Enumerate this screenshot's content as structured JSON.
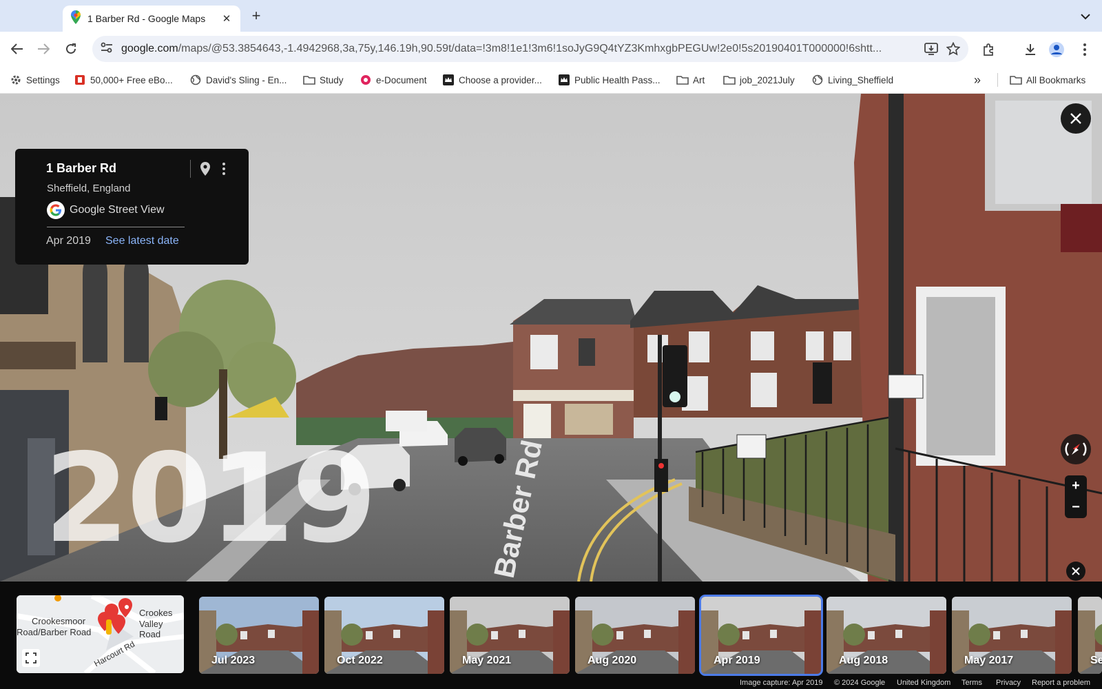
{
  "browser": {
    "tab_title": "1 Barber Rd - Google Maps",
    "url_host": "google.com",
    "url_path": "/maps/@53.3854643,-1.4942968,3a,75y,146.19h,90.59t/data=!3m8!1e1!3m6!1soJyG9Q4tYZ3KmhxgbPEGUw!2e0!5s20190401T000000!6shtt..."
  },
  "bookmarks": {
    "items": [
      {
        "label": "Settings",
        "icon": "gear-icon"
      },
      {
        "label": "50,000+ Free eBo...",
        "icon": "book-icon"
      },
      {
        "label": "David's Sling - En...",
        "icon": "globe-icon"
      },
      {
        "label": "Study",
        "icon": "folder-icon"
      },
      {
        "label": "e-Document",
        "icon": "doc-icon"
      },
      {
        "label": "Choose a provider...",
        "icon": "crown-icon"
      },
      {
        "label": "Public Health Pass...",
        "icon": "crown-icon"
      },
      {
        "label": "Art",
        "icon": "folder-icon"
      },
      {
        "label": "job_2021July",
        "icon": "folder-icon"
      },
      {
        "label": "Living_Sheffield",
        "icon": "globe-icon"
      }
    ],
    "all_bookmarks": "All Bookmarks"
  },
  "infocard": {
    "title": "1 Barber Rd",
    "subtitle": "Sheffield, England",
    "brand": "Google Street View",
    "date": "Apr 2019",
    "latest_link": "See latest date"
  },
  "scene": {
    "year_overlay": "2019",
    "road_text": "Barber Rd"
  },
  "minimap": {
    "label_1_line1": "Crookesmoor",
    "label_1_line2": "Road/Barber Road",
    "label_2_line1": "Crookes",
    "label_2_line2": "Valley Road",
    "label_3": "Harcourt Rd"
  },
  "timeline": [
    {
      "label": "Jul 2023",
      "selected": false
    },
    {
      "label": "Oct 2022",
      "selected": false
    },
    {
      "label": "May 2021",
      "selected": false
    },
    {
      "label": "Aug 2020",
      "selected": false
    },
    {
      "label": "Apr 2019",
      "selected": true
    },
    {
      "label": "Aug 2018",
      "selected": false
    },
    {
      "label": "May 2017",
      "selected": false
    },
    {
      "label": "Se",
      "selected": false
    }
  ],
  "footer": {
    "capture": "Image capture: Apr 2019",
    "copyright": "© 2024 Google",
    "region": "United Kingdom",
    "terms": "Terms",
    "privacy": "Privacy",
    "report": "Report a problem"
  },
  "colors": {
    "accent": "#4c7be8",
    "link": "#8ab4f8",
    "tab_strip": "#dce6f7"
  }
}
